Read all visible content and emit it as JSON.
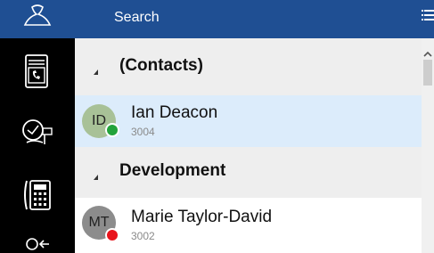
{
  "search": {
    "placeholder": "Search"
  },
  "sidebar": {
    "items": [
      {
        "icon": "contacts-icon"
      },
      {
        "icon": "phonebook-icon"
      },
      {
        "icon": "voicemail-icon"
      },
      {
        "icon": "dialpad-icon"
      },
      {
        "icon": "user-login-icon"
      }
    ]
  },
  "groups": [
    {
      "title": "(Contacts)",
      "contacts": [
        {
          "initials": "ID",
          "name": "Ian Deacon",
          "ext": "3004",
          "status_color": "#23a33b",
          "avatar_color": "#a8c197"
        }
      ]
    },
    {
      "title": "Development",
      "contacts": [
        {
          "initials": "MT",
          "name": "Marie Taylor-David",
          "ext": "3002",
          "status_color": "#e8141c",
          "avatar_color": "#8c8c8c"
        }
      ]
    }
  ],
  "colors": {
    "accent": "#1f4f93",
    "selected_row": "#dcecfb",
    "group_header": "#eeeeee"
  }
}
